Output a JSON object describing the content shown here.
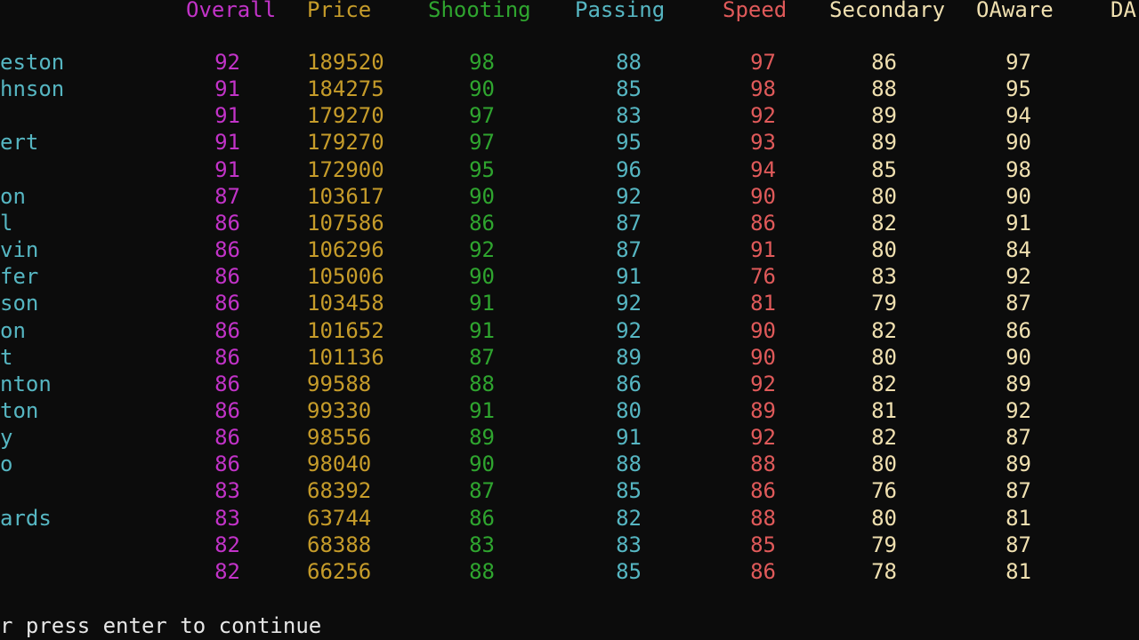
{
  "window": {
    "background": "#0c0c0c"
  },
  "colors": {
    "overall": "#c233c8",
    "price": "#c69c2a",
    "shooting": "#2fa52f",
    "passing": "#56b6c2",
    "speed": "#e05a5a",
    "secondary": "#f0e0b0",
    "oaware": "#f0e0b0",
    "name": "#56b6c2"
  },
  "headers": {
    "overall": "Overall",
    "price": "Price",
    "shooting": "Shooting",
    "passing": "Passing",
    "speed": "Speed",
    "secondary": "Secondary",
    "oaware": "OAware",
    "daware": "DA"
  },
  "rows": [
    {
      "name": "eston",
      "overall": "92",
      "price": "189520",
      "shooting": "98",
      "passing": "88",
      "speed": "97",
      "secondary": "86",
      "oaware": "97"
    },
    {
      "name": "hnson",
      "overall": "91",
      "price": "184275",
      "shooting": "90",
      "passing": "85",
      "speed": "98",
      "secondary": "88",
      "oaware": "95"
    },
    {
      "name": "",
      "overall": "91",
      "price": "179270",
      "shooting": "97",
      "passing": "83",
      "speed": "92",
      "secondary": "89",
      "oaware": "94"
    },
    {
      "name": "ert",
      "overall": "91",
      "price": "179270",
      "shooting": "97",
      "passing": "95",
      "speed": "93",
      "secondary": "89",
      "oaware": "90"
    },
    {
      "name": "",
      "overall": "91",
      "price": "172900",
      "shooting": "95",
      "passing": "96",
      "speed": "94",
      "secondary": "85",
      "oaware": "98"
    },
    {
      "name": "on",
      "overall": "87",
      "price": "103617",
      "shooting": "90",
      "passing": "92",
      "speed": "90",
      "secondary": "80",
      "oaware": "90"
    },
    {
      "name": "l",
      "overall": "86",
      "price": "107586",
      "shooting": "86",
      "passing": "87",
      "speed": "86",
      "secondary": "82",
      "oaware": "91"
    },
    {
      "name": "vin",
      "overall": "86",
      "price": "106296",
      "shooting": "92",
      "passing": "87",
      "speed": "91",
      "secondary": "80",
      "oaware": "84"
    },
    {
      "name": "fer",
      "overall": "86",
      "price": "105006",
      "shooting": "90",
      "passing": "91",
      "speed": "76",
      "secondary": "83",
      "oaware": "92"
    },
    {
      "name": "son",
      "overall": "86",
      "price": "103458",
      "shooting": "91",
      "passing": "92",
      "speed": "81",
      "secondary": "79",
      "oaware": "87"
    },
    {
      "name": "on",
      "overall": "86",
      "price": "101652",
      "shooting": "91",
      "passing": "92",
      "speed": "90",
      "secondary": "82",
      "oaware": "86"
    },
    {
      "name": "t",
      "overall": "86",
      "price": "101136",
      "shooting": "87",
      "passing": "89",
      "speed": "90",
      "secondary": "80",
      "oaware": "90"
    },
    {
      "name": "nton",
      "overall": "86",
      "price": "99588",
      "shooting": "88",
      "passing": "86",
      "speed": "92",
      "secondary": "82",
      "oaware": "89"
    },
    {
      "name": "ton",
      "overall": "86",
      "price": "99330",
      "shooting": "91",
      "passing": "80",
      "speed": "89",
      "secondary": "81",
      "oaware": "92"
    },
    {
      "name": "y",
      "overall": "86",
      "price": "98556",
      "shooting": "89",
      "passing": "91",
      "speed": "92",
      "secondary": "82",
      "oaware": "87"
    },
    {
      "name": "o",
      "overall": "86",
      "price": "98040",
      "shooting": "90",
      "passing": "88",
      "speed": "88",
      "secondary": "80",
      "oaware": "89"
    },
    {
      "name": "",
      "overall": "83",
      "price": "68392",
      "shooting": "87",
      "passing": "85",
      "speed": "86",
      "secondary": "76",
      "oaware": "87"
    },
    {
      "name": "ards",
      "overall": "83",
      "price": "63744",
      "shooting": "86",
      "passing": "82",
      "speed": "88",
      "secondary": "80",
      "oaware": "81"
    },
    {
      "name": "",
      "overall": "82",
      "price": "68388",
      "shooting": "83",
      "passing": "83",
      "speed": "85",
      "secondary": "79",
      "oaware": "87"
    },
    {
      "name": "",
      "overall": "82",
      "price": "66256",
      "shooting": "88",
      "passing": "85",
      "speed": "86",
      "secondary": "78",
      "oaware": "81"
    }
  ],
  "prompt": "r press enter to continue"
}
